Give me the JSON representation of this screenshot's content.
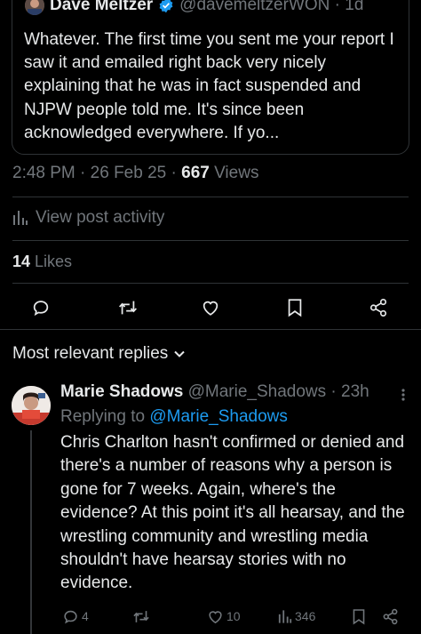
{
  "quoted_post": {
    "author_name": "Dave Meltzer",
    "author_handle": "@davemeltzerWON · 1d",
    "text": "Whatever.  The first time you sent me your report I saw it and emailed right back very nicely explaining that he was in fact suspended and NJPW people told me.    It's since been acknowledged everywhere.  If yo..."
  },
  "post_meta": {
    "time": "2:48 PM",
    "dot1": " · ",
    "date": "26 Feb 25",
    "dot2": " · ",
    "views_count": "667",
    "views_label": " Views"
  },
  "activity": {
    "label": "View post activity",
    "icon": "bar-chart-icon"
  },
  "likes": {
    "count": "14",
    "label": " Likes"
  },
  "actions": {
    "icons": [
      "reply-icon",
      "repost-icon",
      "like-icon",
      "bookmark-icon",
      "share-icon"
    ]
  },
  "replies_section": {
    "label": "Most relevant replies"
  },
  "reply": {
    "author_name": "Marie Shadows",
    "author_handle": "@Marie_Shadows · 23h",
    "replying_prefix": "Replying to ",
    "replying_handle": "@Marie_Shadows",
    "text": "Chris Charlton hasn't confirmed or denied and there's a number of reasons why a person is gone for 7 weeks. Again, where's the evidence? At this point it's all hearsay, and the wrestling community and wrestling media shouldn't have hearsay stories with no evidence.",
    "reply_count": "4",
    "like_count": "10",
    "view_count": "346"
  },
  "colors": {
    "background": "#000000",
    "text": "#e7e9ea",
    "muted": "#71767b",
    "link": "#1d9bf0",
    "border": "#2f3336"
  }
}
